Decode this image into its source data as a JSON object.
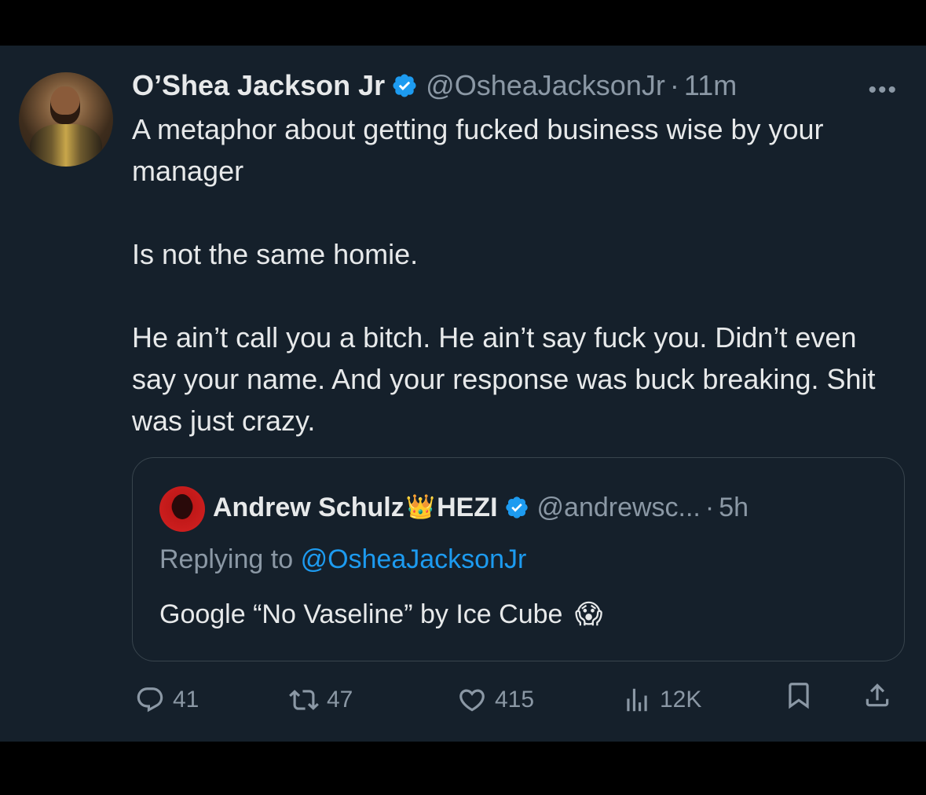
{
  "tweet": {
    "author_name": "O’Shea Jackson Jr",
    "handle": "@OsheaJacksonJr",
    "separator": "·",
    "time": "11m",
    "more": "•••",
    "paragraphs": [
      "A metaphor about getting fucked business wise by your manager",
      "Is not the same homie.",
      "He ain’t call you a bitch. He ain’t say fuck you. Didn’t even say your name. And your response was buck breaking. Shit was just crazy."
    ]
  },
  "quote": {
    "author_name": "Andrew Schulz",
    "crown_emoji": "👑",
    "name_suffix": "HEZI",
    "handle": "@andrewsc...",
    "separator": "·",
    "time": "5h",
    "replying_prefix": "Replying to",
    "replying_to": "@OsheaJacksonJr",
    "text": "Google “No Vaseline” by Ice Cube",
    "emoji": "😱"
  },
  "actions": {
    "replies": "41",
    "reposts": "47",
    "likes": "415",
    "views": "12K"
  },
  "colors": {
    "background": "#15202b",
    "text": "#e7e9ea",
    "secondary": "#8b98a5",
    "accent": "#1d9bf0",
    "border": "#38444d"
  }
}
